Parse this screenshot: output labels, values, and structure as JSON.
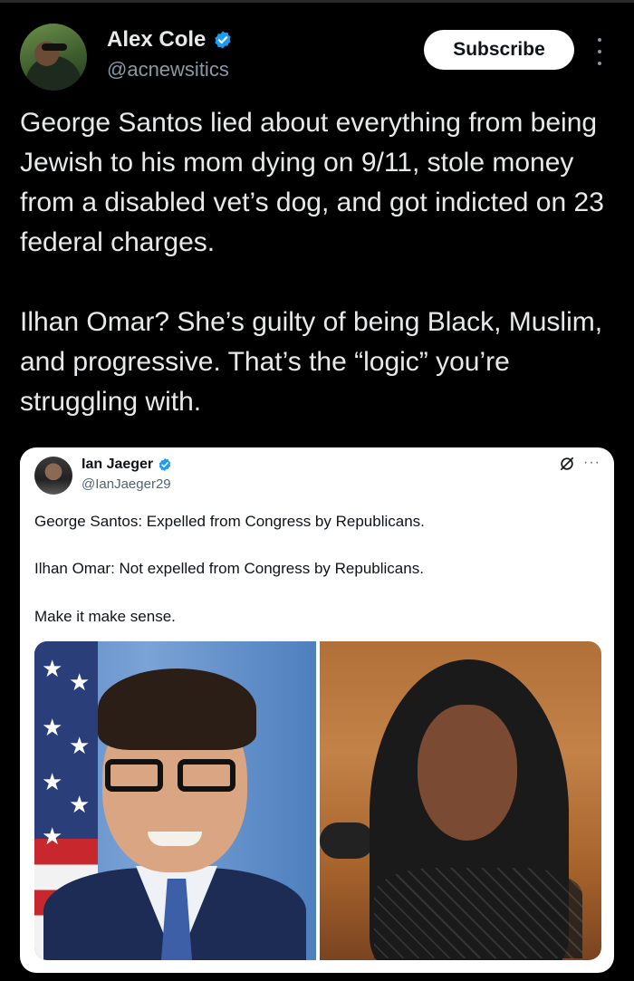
{
  "post": {
    "author_name": "Alex Cole",
    "author_handle": "@acnewsitics",
    "subscribe_label": "Subscribe",
    "body": "George Santos lied about everything from being Jewish to his mom dying on 9/11, stole money from a disabled vet’s dog, and got indicted on 23 federal charges.\n\nIlhan Omar? She’s guilty of being Black, Muslim, and progressive. That’s the “logic” you’re struggling with."
  },
  "quoted": {
    "author_name": "Ian Jaeger",
    "author_handle": "@IanJaeger29",
    "more_label": "···",
    "lines": [
      "George Santos: Expelled from Congress by Republicans.",
      "Ilhan Omar: Not expelled from Congress by Republicans.",
      "Make it make sense."
    ]
  },
  "colors": {
    "verified": "#1d9bf0",
    "background": "#000000",
    "text": "#e7e9ea",
    "handle": "#8b98a5"
  }
}
